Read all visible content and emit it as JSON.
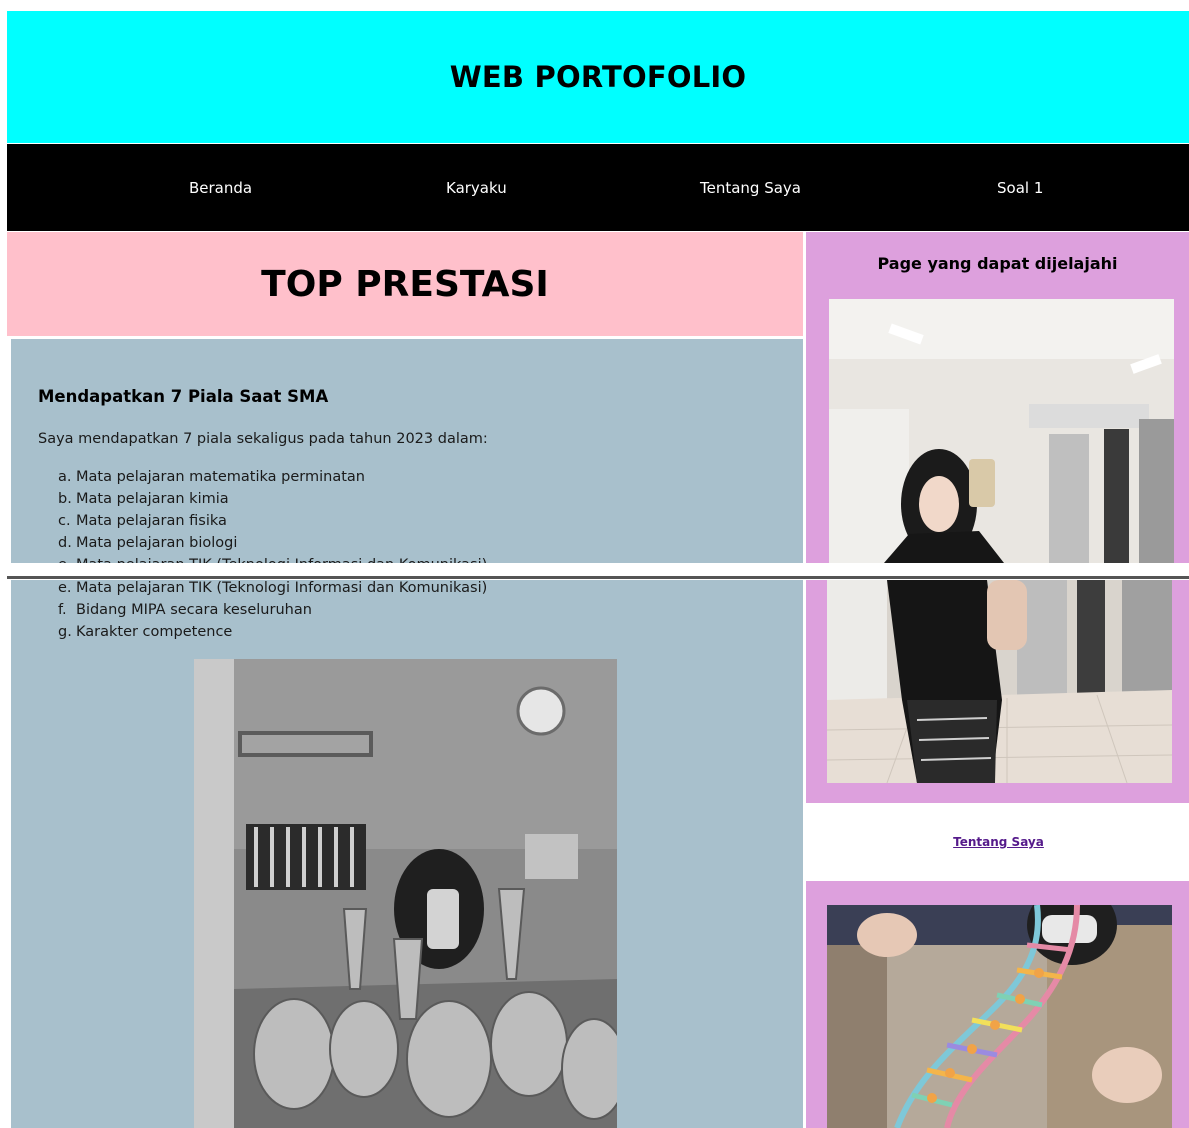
{
  "header": {
    "title": "WEB PORTOFOLIO"
  },
  "nav": {
    "items": [
      {
        "label": "Beranda"
      },
      {
        "label": "Karyaku"
      },
      {
        "label": "Tentang Saya"
      },
      {
        "label": "Soal 1"
      }
    ]
  },
  "main": {
    "title": "TOP PRESTASI",
    "heading": "Mendapatkan 7 Piala Saat SMA",
    "intro": "Saya mendapatkan 7 piala sekaligus pada tahun 2023 dalam:",
    "list": [
      {
        "marker": "a.",
        "text": "Mata pelajaran matematika perminatan"
      },
      {
        "marker": "b.",
        "text": "Mata pelajaran kimia"
      },
      {
        "marker": "c.",
        "text": "Mata pelajaran fisika"
      },
      {
        "marker": "d.",
        "text": "Mata pelajaran biologi"
      },
      {
        "marker": "e.",
        "text": "Mata pelajaran TIK (Teknologi Informasi dan Komunikasi)"
      },
      {
        "marker": "f.",
        "text": "Bidang MIPA secara keseluruhan"
      },
      {
        "marker": "g.",
        "text": "Karakter competence"
      }
    ]
  },
  "sidebar": {
    "title": "Page yang dapat dijelajahi",
    "link_label": "Tentang Saya"
  },
  "colors": {
    "header_bg": "#00ffff",
    "nav_bg": "#000000",
    "title_bg": "#ffc0cb",
    "content_bg": "#a8c0cc",
    "sidebar_bg": "#dda0dd",
    "link": "#551a8b"
  }
}
